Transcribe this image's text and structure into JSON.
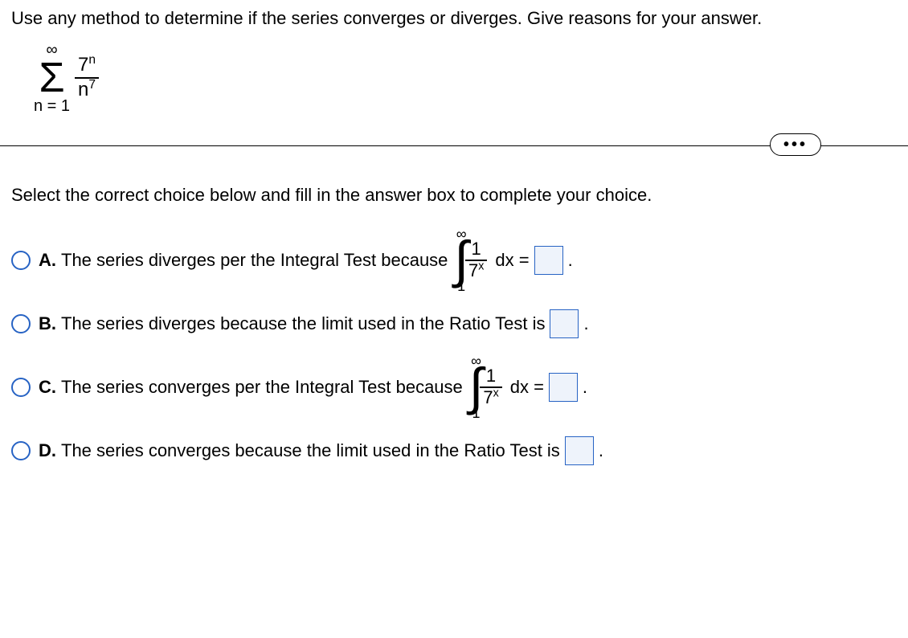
{
  "question": "Use any method to determine if the series converges or diverges. Give reasons for your answer.",
  "series": {
    "sigma_top": "∞",
    "sigma_bottom": "n = 1",
    "numerator_base": "7",
    "numerator_exp": "n",
    "denominator_base": "n",
    "denominator_exp": "7"
  },
  "dots": "•••",
  "instructions": "Select the correct choice below and fill in the answer box to complete your choice.",
  "choices": {
    "a": {
      "letter": "A.",
      "text_pre": "The series diverges per the Integral Test because",
      "int_top": "∞",
      "int_bot": "1",
      "frac_num": "1",
      "frac_den_base": "7",
      "frac_den_exp": "x",
      "dx": "dx =",
      "period": "."
    },
    "b": {
      "letter": "B.",
      "text": "The series diverges because the limit used in the Ratio Test is",
      "period": "."
    },
    "c": {
      "letter": "C.",
      "text_pre": "The series converges per the Integral Test because",
      "int_top": "∞",
      "int_bot": "1",
      "frac_num": "1",
      "frac_den_base": "7",
      "frac_den_exp": "x",
      "dx": "dx =",
      "period": "."
    },
    "d": {
      "letter": "D.",
      "text": "The series converges because the limit used in the Ratio Test is",
      "period": "."
    }
  }
}
